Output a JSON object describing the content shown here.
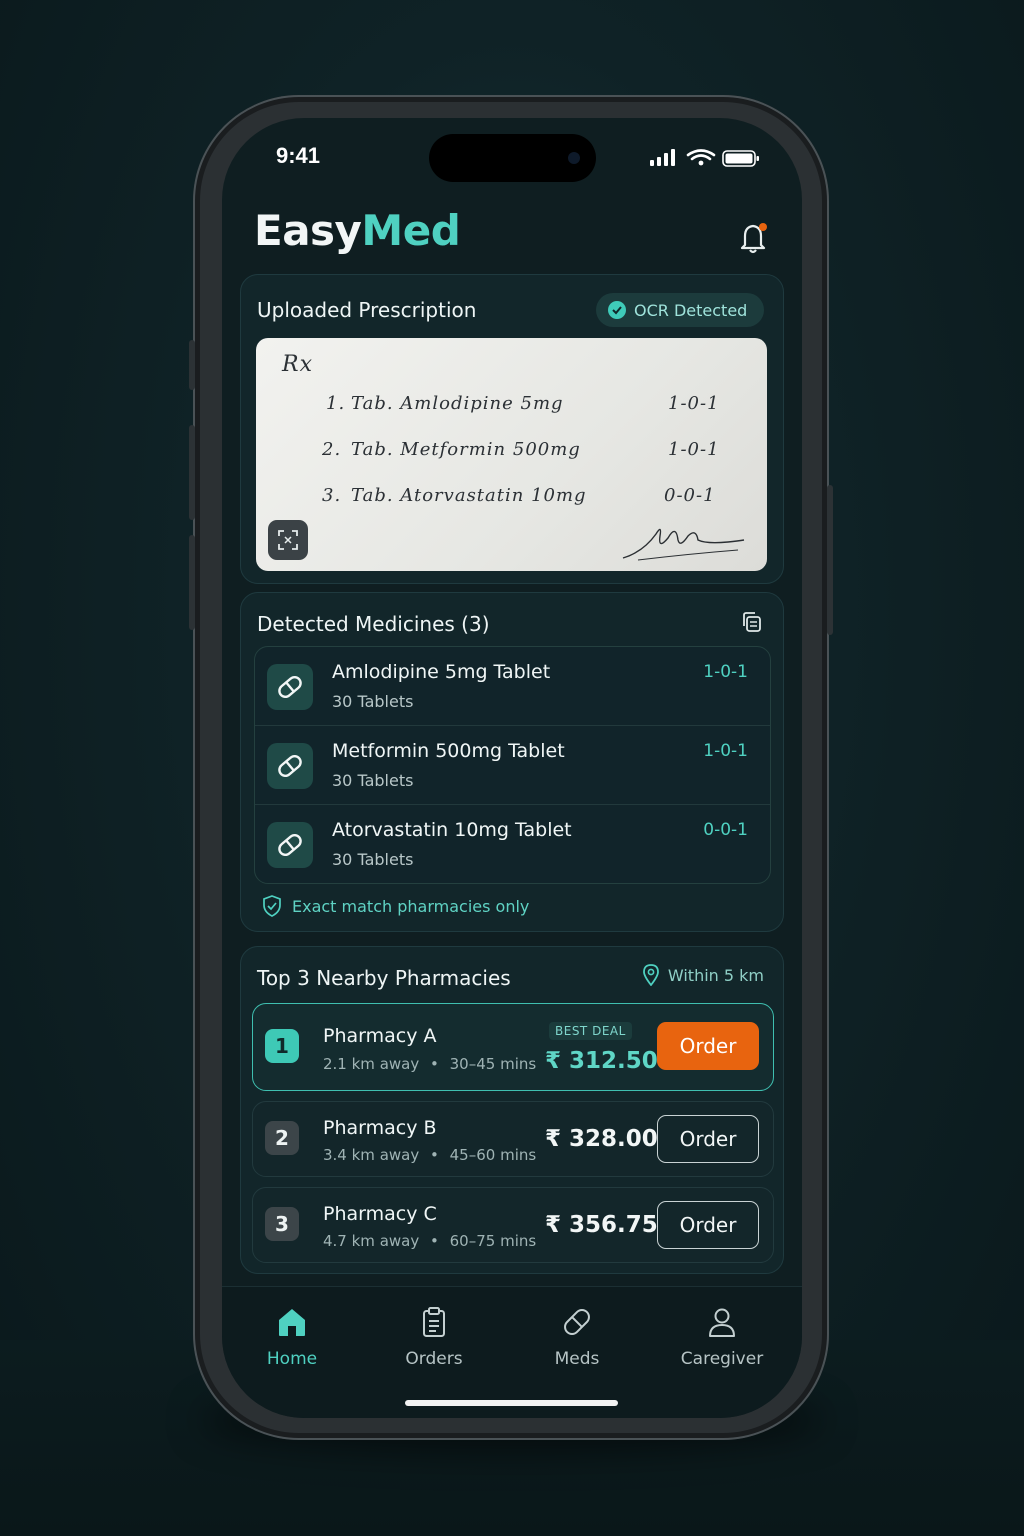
{
  "status_bar": {
    "time": "9:41"
  },
  "app": {
    "logo_part1": "Easy",
    "logo_part2": "Med"
  },
  "prescription": {
    "title": "Uploaded Prescription",
    "ocr_badge": "OCR Detected",
    "rx_symbol": "Rx",
    "lines": [
      {
        "num": "1.",
        "text": "Tab. Amlodipine 5mg",
        "dose": "1-0-1"
      },
      {
        "num": "2.",
        "text": "Tab. Metformin 500mg",
        "dose": "1-0-1"
      },
      {
        "num": "3.",
        "text": "Tab. Atorvastatin 10mg",
        "dose": "0-0-1"
      }
    ]
  },
  "medicines": {
    "title": "Detected Medicines (3)",
    "items": [
      {
        "name": "Amlodipine 5mg Tablet",
        "qty": "30 Tablets",
        "dose": "1-0-1"
      },
      {
        "name": "Metformin 500mg Tablet",
        "qty": "30 Tablets",
        "dose": "1-0-1"
      },
      {
        "name": "Atorvastatin 10mg Tablet",
        "qty": "30 Tablets",
        "dose": "0-0-1"
      }
    ],
    "exact_match_note": "Exact match pharmacies only"
  },
  "pharmacies": {
    "title": "Top 3 Nearby Pharmacies",
    "radius": "Within 5 km",
    "best_deal_label": "BEST DEAL",
    "order_label": "Order",
    "items": [
      {
        "rank": "1",
        "name": "Pharmacy A",
        "distance": "2.1 km away",
        "eta": "30–45 mins",
        "price": "₹ 312.50"
      },
      {
        "rank": "2",
        "name": "Pharmacy B",
        "distance": "3.4 km away",
        "eta": "45–60 mins",
        "price": "₹ 328.00"
      },
      {
        "rank": "3",
        "name": "Pharmacy C",
        "distance": "4.7 km away",
        "eta": "60–75 mins",
        "price": "₹ 356.75"
      }
    ],
    "meta_separator": "•"
  },
  "nav": {
    "items": [
      {
        "label": "Home",
        "icon": "home-icon"
      },
      {
        "label": "Orders",
        "icon": "clipboard-icon"
      },
      {
        "label": "Meds",
        "icon": "pill-icon"
      },
      {
        "label": "Caregiver",
        "icon": "person-icon"
      }
    ]
  },
  "colors": {
    "accent": "#4fd1c1",
    "primary_button": "#e8640f",
    "background": "#0f1e21"
  }
}
